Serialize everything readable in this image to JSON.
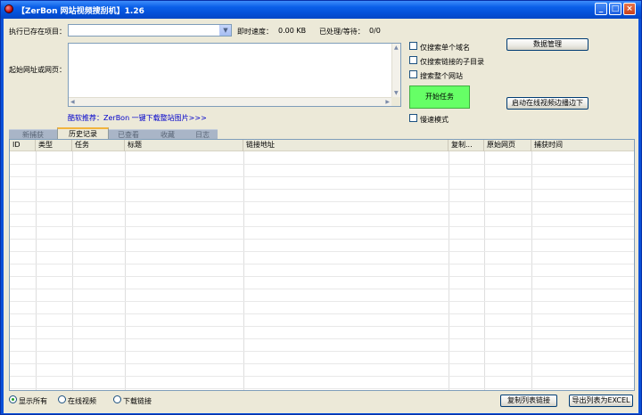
{
  "window": {
    "title": "【ZerBon 网站视频搜刮机】1.26",
    "minimize_glyph": "_",
    "maximize_glyph": "□",
    "close_glyph": "×"
  },
  "top": {
    "project_label": "执行已存在项目：",
    "project_value": "",
    "speed_label": "即时速度：",
    "speed_value": "0.00 KB",
    "progress_label": "已处理/等待：",
    "progress_value": "0/0",
    "start_url_label": "起始网址或网页：",
    "start_url_value": "",
    "promo_link": "酷软推荐：ZerBon 一键下载整站图片>>>"
  },
  "options": {
    "single_domain": "仅搜索单个域名",
    "subdirs_only": "仅搜索链接的子目录",
    "whole_site": "搜索整个网站",
    "slow_mode": "慢速模式"
  },
  "buttons": {
    "data_manage": "数据管理",
    "start_task": "开始任务",
    "launch_online": "启动在线视频边播边下",
    "copy_list": "复制列表链接",
    "export_excel": "导出列表为EXCEL"
  },
  "tabs": [
    {
      "label": "新捕获",
      "active": false
    },
    {
      "label": "历史记录",
      "active": true
    },
    {
      "label": "已查看",
      "active": false
    },
    {
      "label": "收藏",
      "active": false
    },
    {
      "label": "日志",
      "active": false
    }
  ],
  "table": {
    "columns": [
      "ID",
      "类型",
      "任务",
      "标题",
      "链接地址",
      "复制...",
      "原始网页",
      "捕获时间"
    ],
    "rows": []
  },
  "filters": {
    "show_all": "显示所有",
    "online_video": "在线视频",
    "download_links": "下载链接",
    "selected": "show_all"
  }
}
